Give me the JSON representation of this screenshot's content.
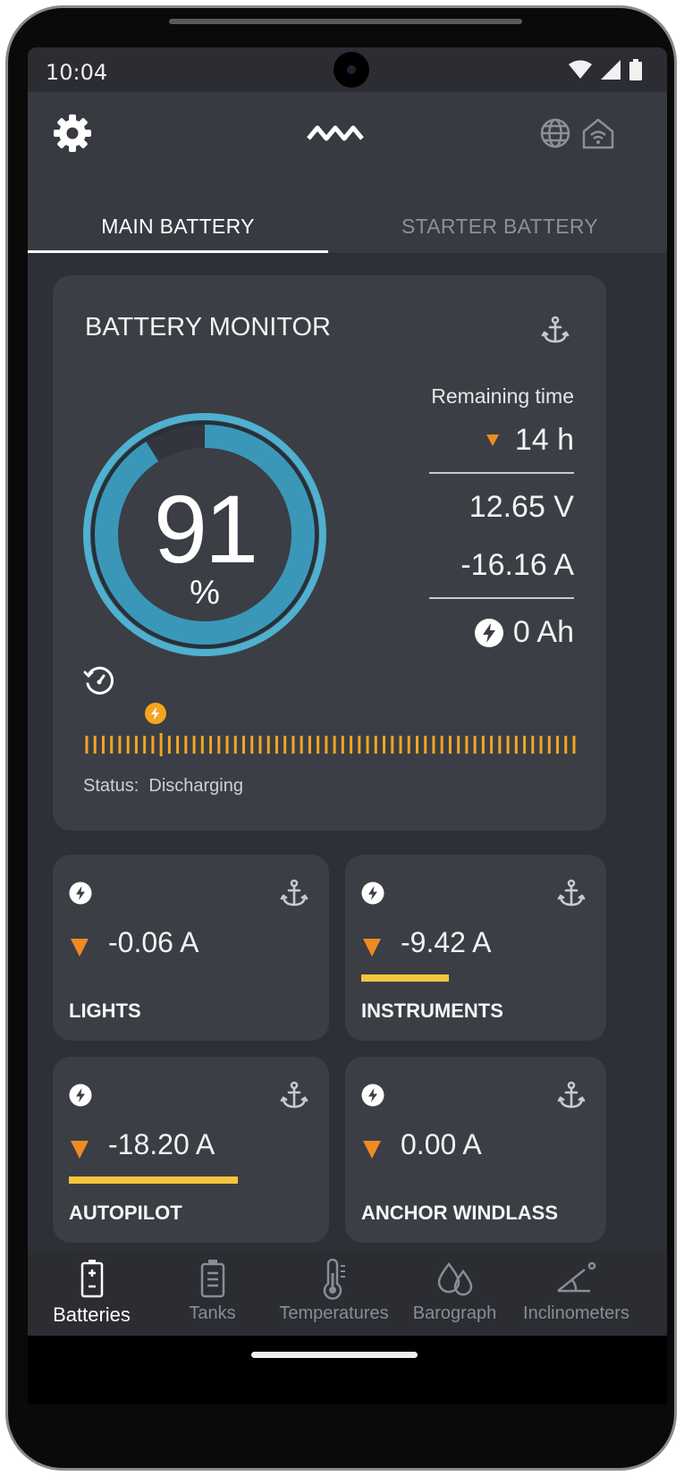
{
  "status_bar": {
    "time": "10:04"
  },
  "tabs": [
    {
      "label": "MAIN BATTERY",
      "active": true
    },
    {
      "label": "STARTER BATTERY",
      "active": false
    }
  ],
  "monitor": {
    "title": "BATTERY MONITOR",
    "soc_value": "91",
    "soc_unit": "%",
    "soc_fraction": 0.91,
    "remaining_label": "Remaining time",
    "remaining_value": "14 h",
    "voltage": "12.65 V",
    "current": "-16.16 A",
    "consumed": "0 Ah",
    "status_label": "Status:",
    "status_value": "Discharging"
  },
  "loads": [
    {
      "name": "LIGHTS",
      "value": "-0.06 A",
      "level": 0
    },
    {
      "name": "INSTRUMENTS",
      "value": "-9.42 A",
      "level": 0.52
    },
    {
      "name": "AUTOPILOT",
      "value": "-18.20 A",
      "level": 1.0
    },
    {
      "name": "ANCHOR WINDLASS",
      "value": "0.00 A",
      "level": 0
    }
  ],
  "nav": [
    {
      "label": "Batteries",
      "icon": "battery-icon",
      "active": true
    },
    {
      "label": "Tanks",
      "icon": "tank-icon",
      "active": false
    },
    {
      "label": "Temperatures",
      "icon": "thermometer-icon",
      "active": false
    },
    {
      "label": "Barograph",
      "icon": "droplets-icon",
      "active": false
    },
    {
      "label": "Inclinometers",
      "icon": "inclinometer-icon",
      "active": false
    }
  ],
  "colors": {
    "background": "#2d3037",
    "card": "#3b3e45",
    "gauge": "#3a97b8",
    "accent_orange": "#f08a24",
    "bar_yellow": "#f4c63d"
  }
}
